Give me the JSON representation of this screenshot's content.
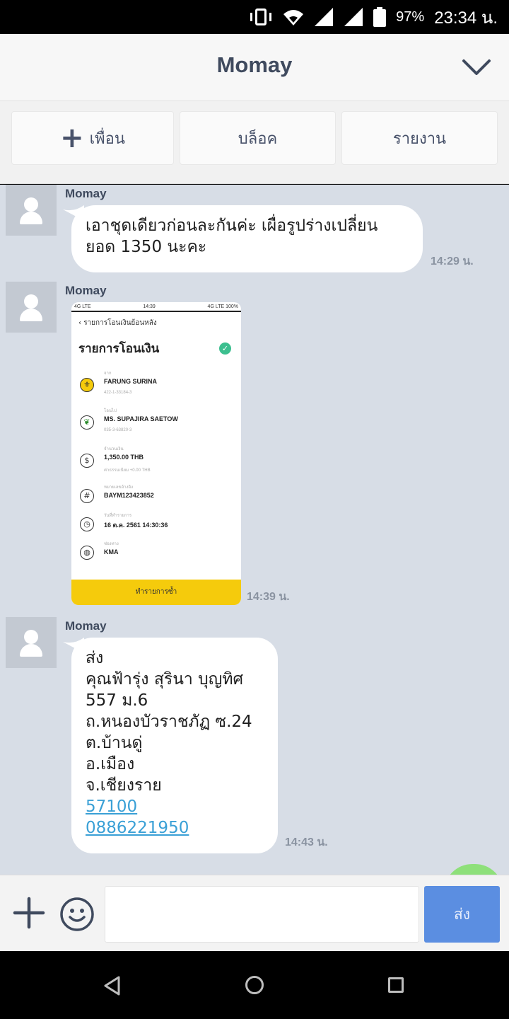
{
  "status_bar": {
    "battery": "97%",
    "time": "23:34 น."
  },
  "header": {
    "title": "Momay"
  },
  "actions": {
    "friend_label": "เพื่อน",
    "block_label": "บล็อค",
    "report_label": "รายงาน"
  },
  "messages": [
    {
      "sender": "Momay",
      "lines": [
        "เอาชุดเดียวก่อนละกันค่ะ เผื่อรูปร่างเปลี่ยน",
        "ยอด 1350 นะคะ"
      ],
      "time": "14:29 น."
    },
    {
      "sender": "Momay",
      "time": "14:39 น.",
      "image": {
        "status_left": "4G LTE",
        "status_time": "14:39",
        "status_right": "4G LTE 100%",
        "back_label": "รายการโอนเงินย้อนหลัง",
        "title": "รายการโอนเงิน",
        "rows": [
          {
            "label": "จาก",
            "value": "FARUNG SURINA",
            "sub": "422-1-33184-3"
          },
          {
            "label": "โอนไป",
            "value": "MS. SUPAJIRA SAETOW",
            "sub": "035-3-63820-3"
          },
          {
            "label": "จำนวนเงิน",
            "value": "1,350.00 THB",
            "sub": "ค่าธรรมเนียม +0.00 THB"
          },
          {
            "label": "หมายเลขอ้างอิง",
            "value": "BAYM123423852",
            "sub": ""
          },
          {
            "label": "วันที่ทำรายการ",
            "value": "16 ต.ค. 2561 14:30:36",
            "sub": ""
          },
          {
            "label": "ช่องทาง",
            "value": "KMA",
            "sub": ""
          }
        ],
        "button_label": "ทำรายการซ้ำ"
      }
    },
    {
      "sender": "Momay",
      "lines": [
        "ส่ง",
        "คุณฟ้ารุ่ง สุรินา บุญทิศ",
        "557 ม.6",
        "ถ.หนองบัวราชภัฏ ซ.24",
        "ต.บ้านดู่",
        "อ.เมือง",
        "จ.เชียงราย"
      ],
      "links": [
        "57100",
        "0886221950"
      ],
      "time": "14:43 น."
    }
  ],
  "input": {
    "placeholder": "",
    "send_label": "ส่ง"
  },
  "icons": {
    "vibrate": "vibrate-icon",
    "wifi": "wifi-icon",
    "signal": "signal-icon",
    "battery": "battery-icon",
    "chevron": "chevron-down-icon",
    "plus": "plus-icon",
    "emoji": "emoji-icon",
    "nav_back": "back-triangle-icon",
    "nav_home": "home-circle-icon",
    "nav_recents": "recents-square-icon"
  },
  "colors": {
    "chat_bg": "#d7dde6",
    "send_button": "#5b8ee1",
    "link": "#3aa0d6",
    "kbank_button": "#f5cb0c"
  }
}
